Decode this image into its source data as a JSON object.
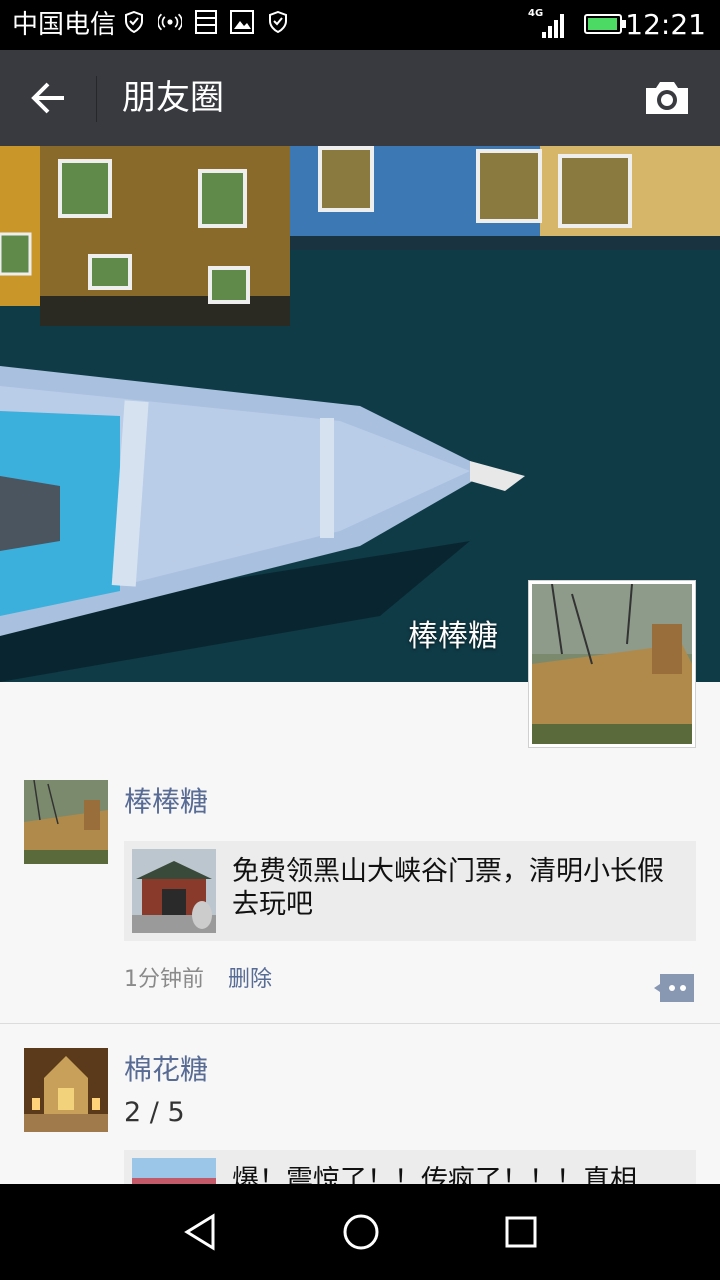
{
  "status_bar": {
    "carrier": "中国电信",
    "network": "4G",
    "time": "12:21",
    "battery_level": 0.95
  },
  "action_bar": {
    "title": "朋友圈",
    "back_icon": "arrow-left-icon",
    "camera_icon": "camera-icon"
  },
  "cover": {
    "user_name": "棒棒糖"
  },
  "posts": [
    {
      "nick": "棒棒糖",
      "link_text": "免费领黑山大峡谷门票，清明小长假去玩吧",
      "time": "1分钟前",
      "delete_label": "删除"
    },
    {
      "nick": "棉花糖",
      "counter": "2 / 5",
      "link_text": "爆！震惊了！！传疯了！！！真相"
    }
  ],
  "colors": {
    "action_bar_bg": "#393a3f",
    "nickname": "#576b95",
    "background": "#f7f7f7"
  }
}
